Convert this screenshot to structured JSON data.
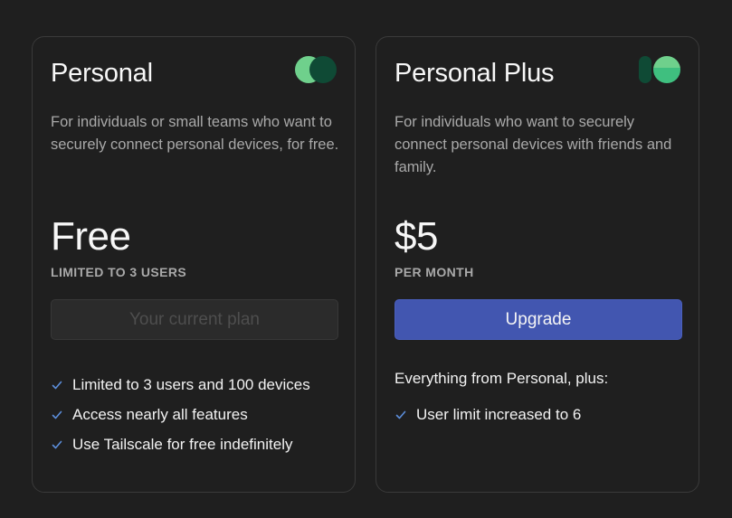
{
  "plans": [
    {
      "title": "Personal",
      "description": "For individuals or small teams who want to securely connect personal devices, for free.",
      "price": "Free",
      "price_note": "LIMITED TO 3 USERS",
      "button_label": "Your current plan",
      "button_state": "disabled",
      "features_lead": "",
      "features": [
        "Limited to 3 users and 100 devices",
        "Access nearly all features",
        "Use Tailscale for free indefinitely"
      ]
    },
    {
      "title": "Personal Plus",
      "description": "For individuals who want to securely connect personal devices with friends and family.",
      "price": "$5",
      "price_note": "PER MONTH",
      "button_label": "Upgrade",
      "button_state": "enabled",
      "features_lead": "Everything from Personal, plus:",
      "features": [
        "User limit increased to 6"
      ]
    }
  ],
  "icons": {
    "check": "check-icon",
    "personal_logo": "personal-plan-logo-icon",
    "personal_plus_logo": "personal-plus-plan-logo-icon"
  },
  "colors": {
    "background": "#1f1f1f",
    "card_border": "#3a3a3a",
    "primary_button": "#4256b0",
    "check": "#5b8dd9",
    "logo_light_green": "#6fd08c",
    "logo_dark_green": "#0f4a35",
    "logo_mid_green": "#3fbf7f"
  }
}
